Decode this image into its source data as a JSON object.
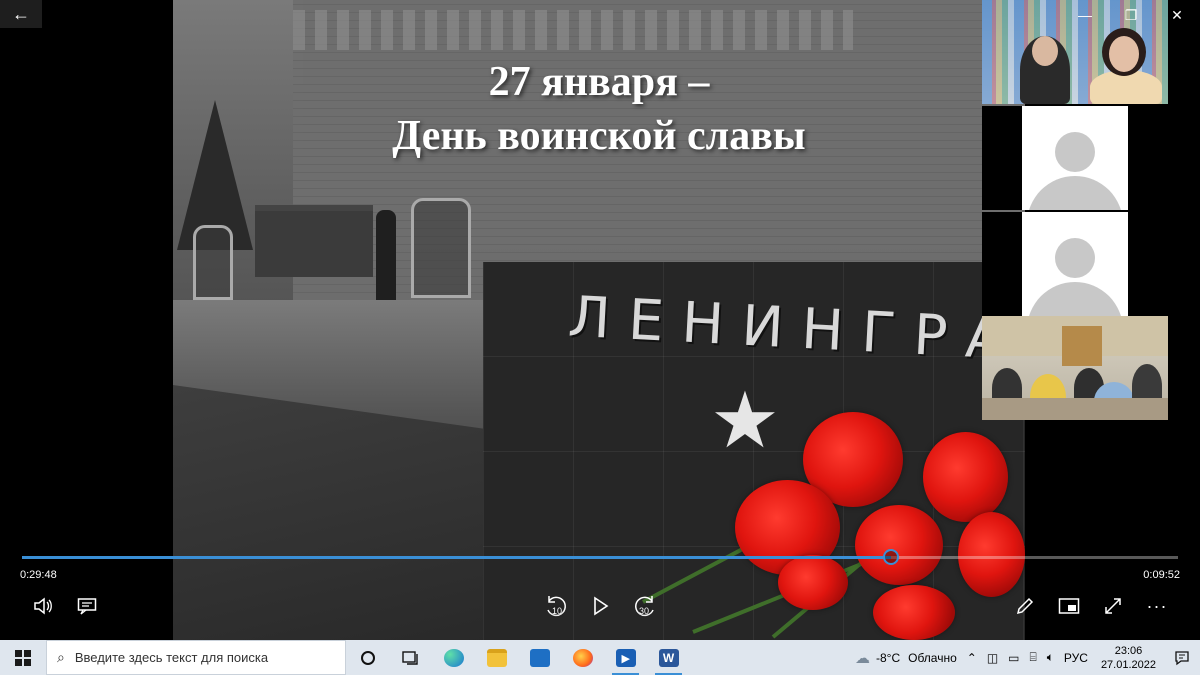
{
  "window": {
    "back_icon": "←",
    "minimize_icon": "—",
    "restore_icon": "❐",
    "close_icon": "✕"
  },
  "slide": {
    "title_line1": "27 января –",
    "title_line2": "День воинской славы",
    "monument_text": "ЛЕНИНГРАД"
  },
  "player": {
    "elapsed": "0:29:48",
    "remaining": "0:09:52",
    "progress_fraction": 0.752,
    "accent_color": "#3a8fd6",
    "skip_back_label": "10",
    "skip_forward_label": "30"
  },
  "taskbar": {
    "search_placeholder": "Введите здесь текст для поиска",
    "weather_temp": "-8°C",
    "weather_desc": "Облачно",
    "language": "РУС",
    "time": "23:06",
    "date": "27.01.2022"
  }
}
